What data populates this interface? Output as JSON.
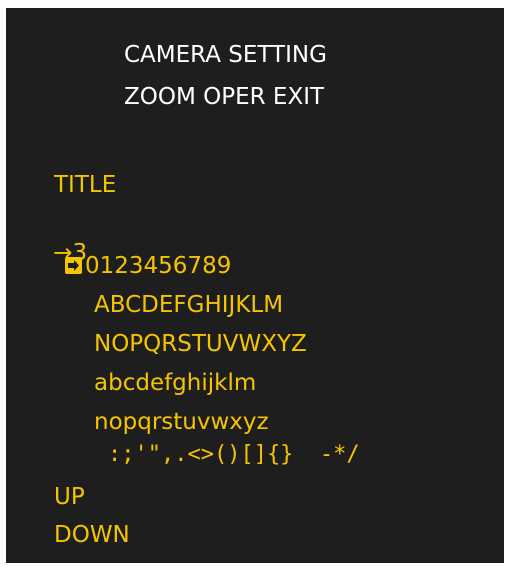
{
  "menu": {
    "title_line1": "CAMERA SETTING",
    "title_line2": "ZOOM OPER EXIT",
    "section_label": "TITLE",
    "current_value_arrow": "→",
    "current_value": "3",
    "char_rows": [
      "0123456789",
      "ABCDEFGHIJKLM",
      "NOPQRSTUVWXYZ",
      "abcdefghijklm",
      "nopqrstuvwxyz",
      ":;'\",.<>()[]{}  -*/"
    ],
    "up_label": "UP",
    "down_label": "DOWN"
  },
  "colors": {
    "background": "#1e1e1e",
    "header_text": "#ffffff",
    "item_text": "#f5c400"
  },
  "icons": {
    "selection_cursor": "cursor-arrow-box-icon",
    "value_pointer": "right-arrow-icon"
  }
}
